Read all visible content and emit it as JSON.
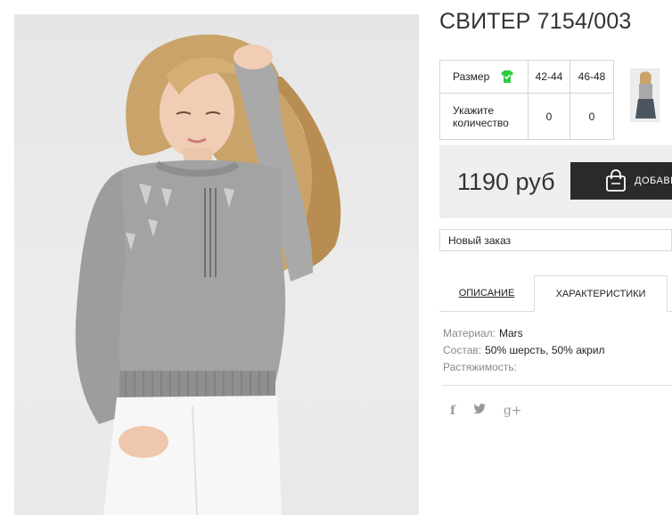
{
  "product": {
    "title": "СВИТЕР 7154/003",
    "image_alt": "model in grey knitted sweater and white jeans"
  },
  "sizes": {
    "row_label_size": "Размер",
    "row_label_qty": "Укажите количество",
    "size_icon": "shirt-icon",
    "columns": [
      "42-44",
      "46-48"
    ],
    "quantities": [
      "0",
      "0"
    ]
  },
  "price": {
    "amount": "1190 руб",
    "add_button": "ДОБАВИТЬ"
  },
  "order": {
    "selected": "Новый заказ"
  },
  "tabs": {
    "description": "ОПИСАНИЕ",
    "characteristics": "ХАРАКТЕРИСТИКИ"
  },
  "specs": [
    {
      "key": "Материал:",
      "value": "Mars"
    },
    {
      "key": "Состав:",
      "value": "50% шерсть, 50% акрил"
    },
    {
      "key": "Растяжимость:",
      "value": ""
    }
  ],
  "social": {
    "facebook": "f",
    "twitter": "🐦",
    "googleplus": "g+"
  },
  "colors": {
    "accent_dark": "#2a2a2a",
    "size_icon_green": "#2ecc40",
    "price_bg": "#efefef"
  }
}
